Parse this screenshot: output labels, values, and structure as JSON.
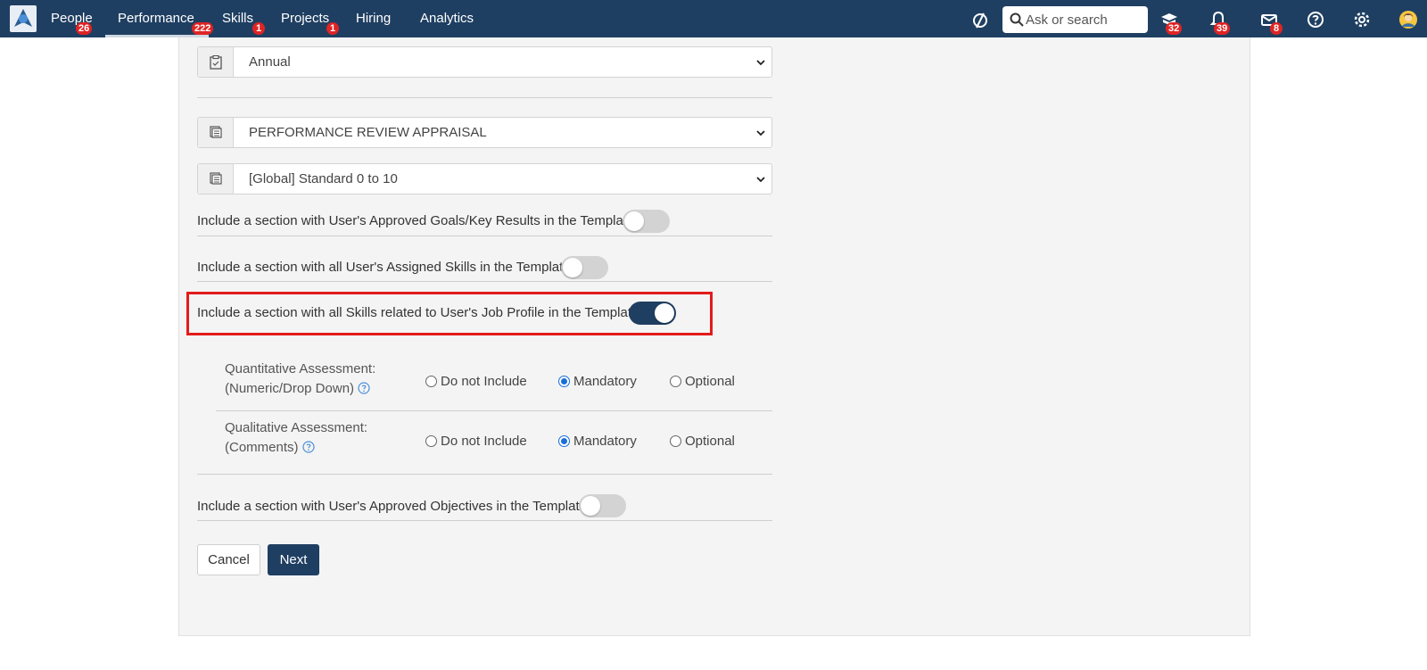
{
  "nav": {
    "items": [
      {
        "label": "People",
        "badge": "26"
      },
      {
        "label": "Performance",
        "badge": "222"
      },
      {
        "label": "Skills",
        "badge": "1"
      },
      {
        "label": "Projects",
        "badge": "1"
      },
      {
        "label": "Hiring"
      },
      {
        "label": "Analytics"
      }
    ],
    "search_placeholder": "Ask or search",
    "badges": {
      "learning": "32",
      "notifications": "39",
      "messages": "8"
    },
    "active_color": "#1f3f62",
    "badge_color": "#e02424"
  },
  "form": {
    "cycle_select": "Annual",
    "template_select": "PERFORMANCE REVIEW APPRAISAL",
    "scale_select": "[Global] Standard 0 to 10",
    "toggles": {
      "goals_label": "Include a section with User's Approved Goals/Key Results in the Template",
      "goals_on": false,
      "assigned_skills_label": "Include a section with all User's Assigned Skills in the Template",
      "assigned_skills_on": false,
      "job_profile_label": "Include a section with all Skills related to User's Job Profile in the Template",
      "job_profile_on": true,
      "objectives_label": "Include a section with User's Approved Objectives in the Template",
      "objectives_on": false
    },
    "quantitative": {
      "label_line1": "Quantitative Assessment:",
      "label_line2": "(Numeric/Drop Down)",
      "options": [
        "Do not Include",
        "Mandatory",
        "Optional"
      ],
      "selected": "Mandatory"
    },
    "qualitative": {
      "label_line1": "Qualitative Assessment:",
      "label_line2": "(Comments)",
      "options": [
        "Do not Include",
        "Mandatory",
        "Optional"
      ],
      "selected": "Mandatory"
    },
    "cancel_label": "Cancel",
    "next_label": "Next",
    "highlight_color": "#e31b1b"
  }
}
